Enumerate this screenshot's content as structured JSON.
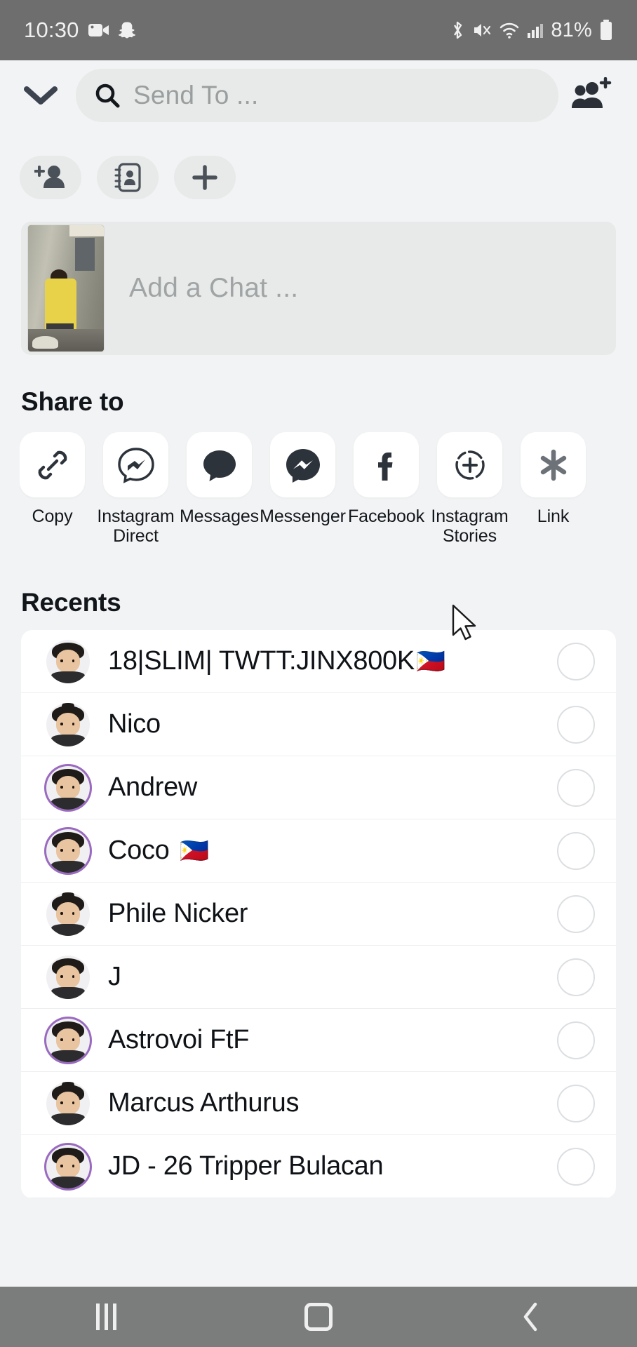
{
  "statusbar": {
    "time": "10:30",
    "battery": "81%",
    "icons_left": [
      "video-camera-icon",
      "snapchat-ghost-icon"
    ],
    "icons_right": [
      "bluetooth-icon",
      "mute-icon",
      "wifi-icon",
      "cellular-signal-icon",
      "battery-icon"
    ]
  },
  "header": {
    "collapse_icon": "chevron-down-icon",
    "search_placeholder": "Send To ...",
    "search_value": "",
    "search_icon": "search-icon",
    "add_group_icon": "add-group-icon"
  },
  "quick_actions": [
    {
      "name": "add-friend",
      "icon": "add-person-icon"
    },
    {
      "name": "contacts",
      "icon": "address-book-icon"
    },
    {
      "name": "new",
      "icon": "plus-icon"
    }
  ],
  "chat_box": {
    "placeholder": "Add a Chat ...",
    "thumbnail": "snap-preview-thumbnail"
  },
  "share": {
    "title": "Share to",
    "items": [
      {
        "label": "Copy",
        "icon": "link-chain-icon"
      },
      {
        "label": "Instagram Direct",
        "icon": "instagram-direct-icon"
      },
      {
        "label": "Messages",
        "icon": "message-bubble-icon"
      },
      {
        "label": "Messenger",
        "icon": "facebook-messenger-icon"
      },
      {
        "label": "Facebook",
        "icon": "facebook-f-icon"
      },
      {
        "label": "Instagram Stories",
        "icon": "instagram-story-plus-icon"
      },
      {
        "label": "Link",
        "icon": "asterisk-icon"
      }
    ]
  },
  "recents": {
    "title": "Recents",
    "rows": [
      {
        "name": "18|SLIM| TWTT:JINX800K",
        "flag": "🇵🇭",
        "ring": false,
        "selected": false,
        "avatar": "bitmoji-avatar"
      },
      {
        "name": "Nico",
        "flag": "",
        "ring": false,
        "selected": false,
        "avatar": "bitmoji-avatar"
      },
      {
        "name": "Andrew",
        "flag": "",
        "ring": true,
        "selected": false,
        "avatar": "bitmoji-avatar"
      },
      {
        "name": "Coco",
        "flag": "🇵🇭",
        "ring": true,
        "selected": false,
        "avatar": "bitmoji-avatar"
      },
      {
        "name": "Phile Nicker",
        "flag": "",
        "ring": false,
        "selected": false,
        "avatar": "bitmoji-avatar"
      },
      {
        "name": "J",
        "flag": "",
        "ring": false,
        "selected": false,
        "avatar": "bitmoji-avatar"
      },
      {
        "name": "Astrovoi FtF",
        "flag": "",
        "ring": true,
        "selected": false,
        "avatar": "bitmoji-avatar"
      },
      {
        "name": "Marcus Arthurus",
        "flag": "",
        "ring": false,
        "selected": false,
        "avatar": "bitmoji-avatar"
      },
      {
        "name": "JD - 26 Tripper Bulacan",
        "flag": "",
        "ring": true,
        "selected": false,
        "avatar": "default-person-avatar"
      }
    ]
  },
  "navbar": {
    "recents_label": "recent-apps",
    "home_label": "home",
    "back_label": "back"
  },
  "colors": {
    "page_bg": "#f2f3f4",
    "statusbar_bg": "#6e6e6e",
    "field_bg": "#e7eae9",
    "card_bg": "#ffffff",
    "text": "#0f1317",
    "placeholder": "#9fa3a3",
    "icon_dark": "#3d4450",
    "ring_purple": "#9a6ac0",
    "divider": "#eceef0"
  }
}
